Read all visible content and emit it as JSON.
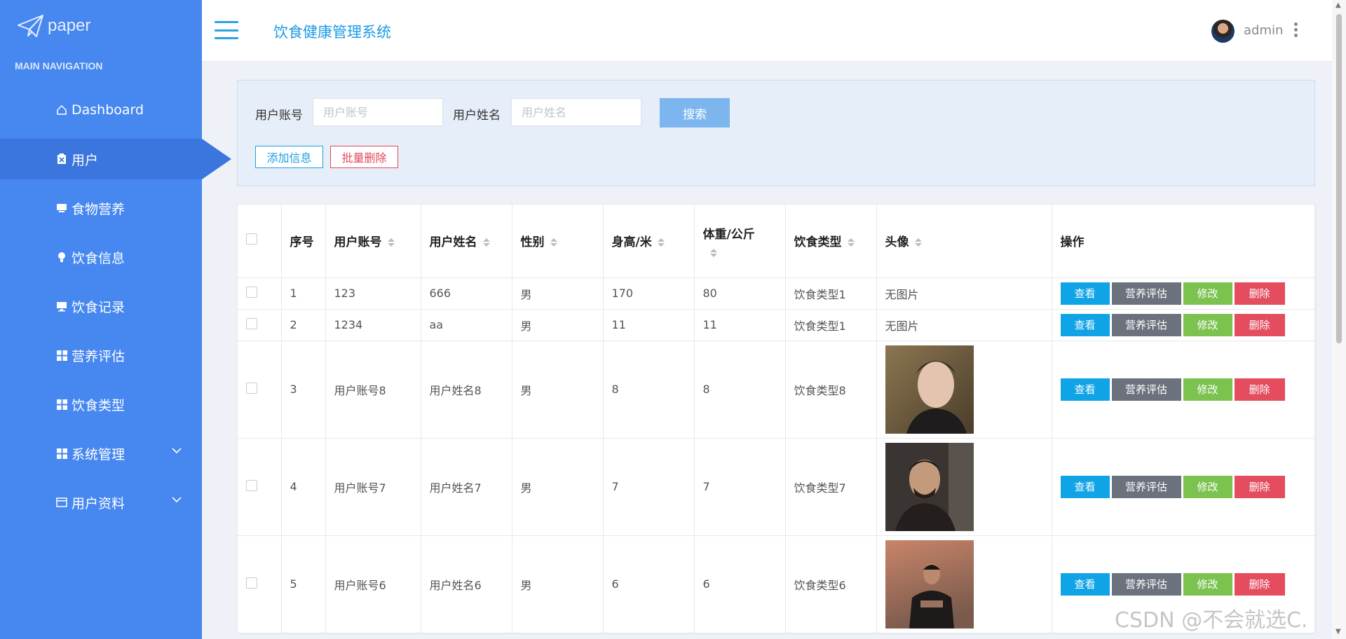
{
  "sidebar": {
    "logo_text": "paper",
    "heading": "MAIN NAVIGATION",
    "items": [
      {
        "label": "Dashboard",
        "icon": "home-icon"
      },
      {
        "label": "用户",
        "icon": "clipboard-icon"
      },
      {
        "label": "食物营养",
        "icon": "tray-icon"
      },
      {
        "label": "饮食信息",
        "icon": "bulb-icon"
      },
      {
        "label": "饮食记录",
        "icon": "monitor-icon"
      },
      {
        "label": "营养评估",
        "icon": "grid-icon"
      },
      {
        "label": "饮食类型",
        "icon": "grid-icon"
      },
      {
        "label": "系统管理",
        "icon": "grid-icon"
      },
      {
        "label": "用户资料",
        "icon": "card-icon"
      }
    ],
    "active_item": "用户"
  },
  "header": {
    "title": "饮食健康管理系统",
    "username": "admin"
  },
  "search": {
    "account_label": "用户账号",
    "account_placeholder": "用户账号",
    "account_value": "",
    "name_label": "用户姓名",
    "name_placeholder": "用户姓名",
    "name_value": "",
    "search_button": "搜索",
    "add_button": "添加信息",
    "batch_delete_button": "批量删除"
  },
  "table": {
    "columns": [
      "序号",
      "用户账号",
      "用户姓名",
      "性别",
      "身高/米",
      "体重/公斤",
      "饮食类型",
      "头像",
      "操作"
    ],
    "rows": [
      {
        "index": "1",
        "account": "123",
        "name": "666",
        "gender": "男",
        "height": "170",
        "weight": "80",
        "diet_type": "饮食类型1",
        "avatar": "无图片"
      },
      {
        "index": "2",
        "account": "1234",
        "name": "aa",
        "gender": "男",
        "height": "11",
        "weight": "11",
        "diet_type": "饮食类型1",
        "avatar": "无图片"
      },
      {
        "index": "3",
        "account": "用户账号8",
        "name": "用户姓名8",
        "gender": "男",
        "height": "8",
        "weight": "8",
        "diet_type": "饮食类型8",
        "avatar": ""
      },
      {
        "index": "4",
        "account": "用户账号7",
        "name": "用户姓名7",
        "gender": "男",
        "height": "7",
        "weight": "7",
        "diet_type": "饮食类型7",
        "avatar": ""
      },
      {
        "index": "5",
        "account": "用户账号6",
        "name": "用户姓名6",
        "gender": "男",
        "height": "6",
        "weight": "6",
        "diet_type": "饮食类型6",
        "avatar": ""
      }
    ],
    "actions": {
      "view": "查看",
      "evaluate": "营养评估",
      "edit": "修改",
      "delete": "删除"
    }
  },
  "watermark": "CSDN @不会就选C.",
  "colors": {
    "sidebar": "#4687f0",
    "accent": "#1a9be6",
    "view": "#10a4e6",
    "evaluate": "#6b717d",
    "edit": "#7bc24f",
    "delete": "#e34d5e"
  }
}
